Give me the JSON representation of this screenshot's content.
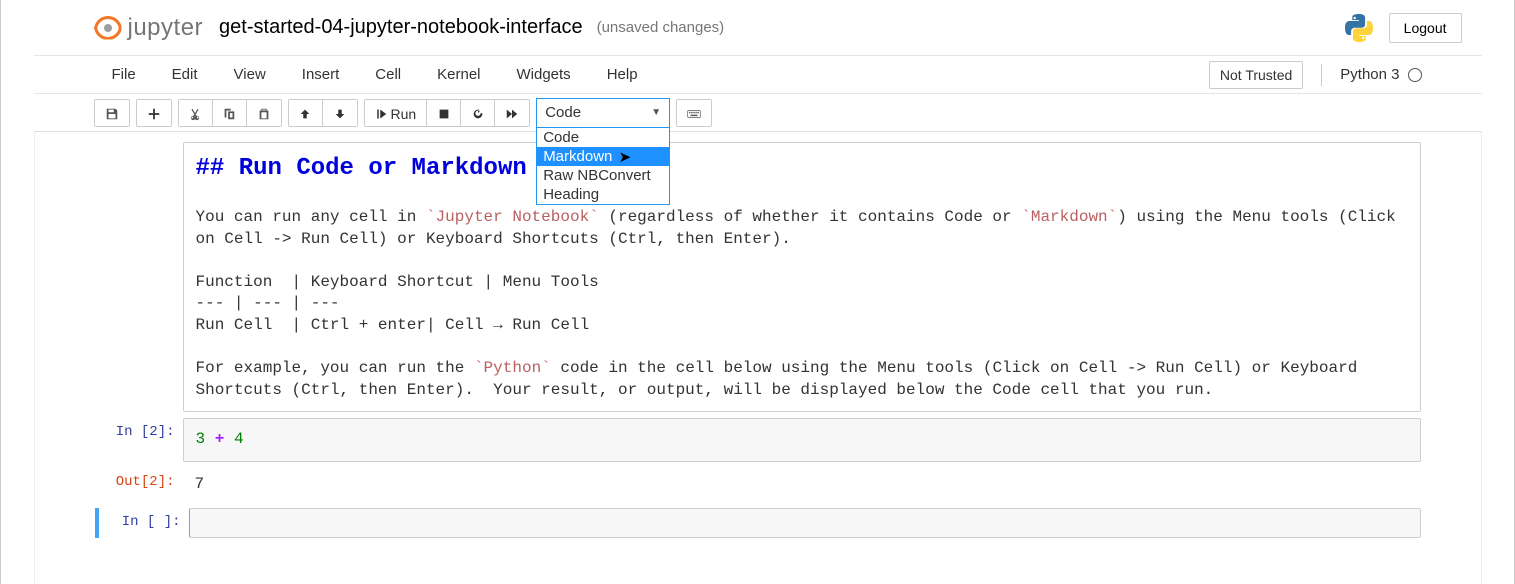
{
  "header": {
    "logo_text": "jupyter",
    "notebook_name": "get-started-04-jupyter-notebook-interface",
    "saved_status": "(unsaved changes)",
    "logout": "Logout"
  },
  "menubar": {
    "items": [
      "File",
      "Edit",
      "View",
      "Insert",
      "Cell",
      "Kernel",
      "Widgets",
      "Help"
    ],
    "trust": "Not Trusted",
    "kernel": "Python 3"
  },
  "toolbar": {
    "run_label": "Run",
    "cell_type_selected": "Code",
    "cell_type_options": [
      "Code",
      "Markdown",
      "Raw NBConvert",
      "Heading"
    ],
    "highlighted_index": 1
  },
  "cells": {
    "markdown": {
      "heading": "## Run Code or Markdown Cells",
      "body_1a": "You can run any cell in ",
      "body_1_code1": "`Jupyter Notebook`",
      "body_1b": " (regardless of whether it contains Code or ",
      "body_1_code2": "`Markdown`",
      "body_1c": ") using the Menu tools (Click on Cell -> Run Cell) or Keyboard Shortcuts (Ctrl, then Enter).",
      "table_l1": "Function  | Keyboard Shortcut | Menu Tools",
      "table_l2": "--- | --- | ---",
      "table_l3": "Run Cell  | Ctrl + enter| Cell → Run Cell",
      "body_2a": "For example, you can run the ",
      "body_2_code1": "`Python`",
      "body_2b": " code in the cell below using the Menu tools (Click on Cell -> Run Cell) or Keyboard Shortcuts (Ctrl, then Enter).  Your result, or output, will be displayed below the Code cell that you run."
    },
    "code1": {
      "in_prompt": "In [2]:",
      "n1": "3",
      "op": "+",
      "n2": "4",
      "out_prompt": "Out[2]:",
      "output": "7"
    },
    "empty": {
      "in_prompt": "In [ ]:"
    }
  }
}
